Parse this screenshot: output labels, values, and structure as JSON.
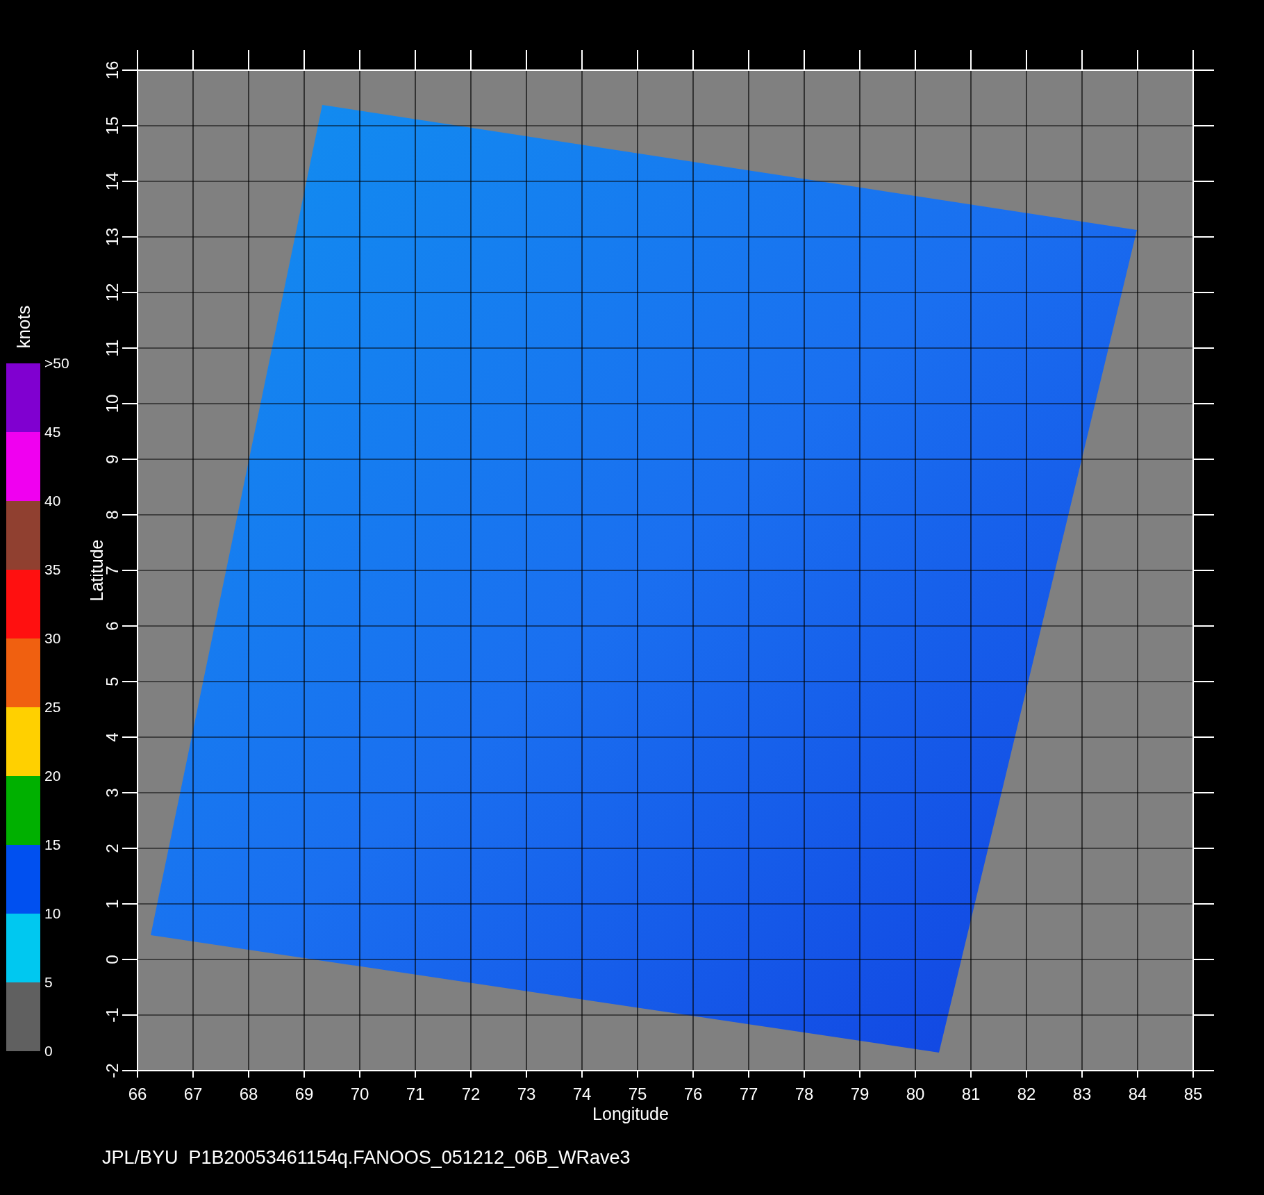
{
  "colorbar": {
    "unit": "knots",
    "bands": [
      {
        "color": "#8000d0"
      },
      {
        "color": "#f000f0"
      },
      {
        "color": "#904030"
      },
      {
        "color": "#ff1010"
      },
      {
        "color": "#f06010"
      },
      {
        "color": "#ffd000"
      },
      {
        "color": "#00b000"
      },
      {
        "color": "#0050f0"
      },
      {
        "color": "#00c8f0"
      },
      {
        "color": "#606060"
      }
    ],
    "labels": [
      ">50",
      "45",
      "40",
      "35",
      "30",
      "25",
      "20",
      "15",
      "10",
      "5",
      "0"
    ]
  },
  "y_axis": {
    "label": "Latitude",
    "ticks": [
      "-2",
      "-1",
      "0",
      "1",
      "2",
      "3",
      "4",
      "5",
      "6",
      "7",
      "8",
      "9",
      "10",
      "11",
      "12",
      "13",
      "14",
      "15",
      "16"
    ]
  },
  "x_axis": {
    "label": "Longitude",
    "ticks": [
      "66",
      "67",
      "68",
      "69",
      "70",
      "71",
      "72",
      "73",
      "74",
      "75",
      "76",
      "77",
      "78",
      "79",
      "80",
      "81",
      "82",
      "83",
      "84",
      "85"
    ]
  },
  "caption": "JPL/BYU  P1B20053461154q.FANOOS_051212_06B_WRave3"
}
